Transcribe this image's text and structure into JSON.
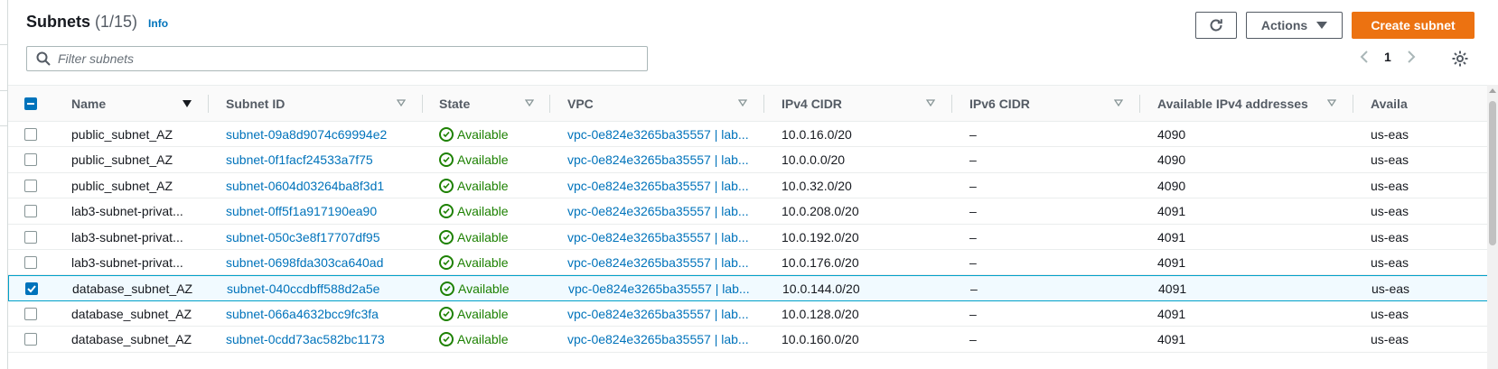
{
  "header": {
    "title": "Subnets",
    "count": "(1/15)",
    "info": "Info"
  },
  "toolbar": {
    "actions_label": "Actions",
    "create_label": "Create subnet"
  },
  "search": {
    "placeholder": "Filter subnets",
    "value": ""
  },
  "pagination": {
    "page": "1"
  },
  "table": {
    "columns": [
      "Name",
      "Subnet ID",
      "State",
      "VPC",
      "IPv4 CIDR",
      "IPv6 CIDR",
      "Available IPv4 addresses",
      "Availa"
    ],
    "rows": [
      {
        "name": "public_subnet_AZ",
        "subnet_id": "subnet-09a8d9074c69994e2",
        "state": "Available",
        "vpc": "vpc-0e824e3265ba35557 | lab...",
        "ipv4": "10.0.16.0/20",
        "ipv6": "–",
        "available": "4090",
        "az": "us-eas",
        "selected": false
      },
      {
        "name": "public_subnet_AZ",
        "subnet_id": "subnet-0f1facf24533a7f75",
        "state": "Available",
        "vpc": "vpc-0e824e3265ba35557 | lab...",
        "ipv4": "10.0.0.0/20",
        "ipv6": "–",
        "available": "4090",
        "az": "us-eas",
        "selected": false
      },
      {
        "name": "public_subnet_AZ",
        "subnet_id": "subnet-0604d03264ba8f3d1",
        "state": "Available",
        "vpc": "vpc-0e824e3265ba35557 | lab...",
        "ipv4": "10.0.32.0/20",
        "ipv6": "–",
        "available": "4090",
        "az": "us-eas",
        "selected": false
      },
      {
        "name": "lab3-subnet-privat...",
        "subnet_id": "subnet-0ff5f1a917190ea90",
        "state": "Available",
        "vpc": "vpc-0e824e3265ba35557 | lab...",
        "ipv4": "10.0.208.0/20",
        "ipv6": "–",
        "available": "4091",
        "az": "us-eas",
        "selected": false
      },
      {
        "name": "lab3-subnet-privat...",
        "subnet_id": "subnet-050c3e8f17707df95",
        "state": "Available",
        "vpc": "vpc-0e824e3265ba35557 | lab...",
        "ipv4": "10.0.192.0/20",
        "ipv6": "–",
        "available": "4091",
        "az": "us-eas",
        "selected": false
      },
      {
        "name": "lab3-subnet-privat...",
        "subnet_id": "subnet-0698fda303ca640ad",
        "state": "Available",
        "vpc": "vpc-0e824e3265ba35557 | lab...",
        "ipv4": "10.0.176.0/20",
        "ipv6": "–",
        "available": "4091",
        "az": "us-eas",
        "selected": false
      },
      {
        "name": "database_subnet_AZ",
        "subnet_id": "subnet-040ccdbff588d2a5e",
        "state": "Available",
        "vpc": "vpc-0e824e3265ba35557 | lab...",
        "ipv4": "10.0.144.0/20",
        "ipv6": "–",
        "available": "4091",
        "az": "us-eas",
        "selected": true
      },
      {
        "name": "database_subnet_AZ",
        "subnet_id": "subnet-066a4632bcc9fc3fa",
        "state": "Available",
        "vpc": "vpc-0e824e3265ba35557 | lab...",
        "ipv4": "10.0.128.0/20",
        "ipv6": "–",
        "available": "4091",
        "az": "us-eas",
        "selected": false
      },
      {
        "name": "database_subnet_AZ",
        "subnet_id": "subnet-0cdd73ac582bc1173",
        "state": "Available",
        "vpc": "vpc-0e824e3265ba35557 | lab...",
        "ipv4": "10.0.160.0/20",
        "ipv6": "–",
        "available": "4091",
        "az": "us-eas",
        "selected": false
      }
    ]
  },
  "colors": {
    "link": "#0073bb",
    "available": "#1d8102",
    "primary": "#ec7211",
    "selected_border": "#00a1c9"
  },
  "icons": {
    "refresh": "refresh-icon",
    "search": "search-icon",
    "settings": "gear-icon",
    "prev": "chevron-left-icon",
    "next": "chevron-right-icon"
  }
}
